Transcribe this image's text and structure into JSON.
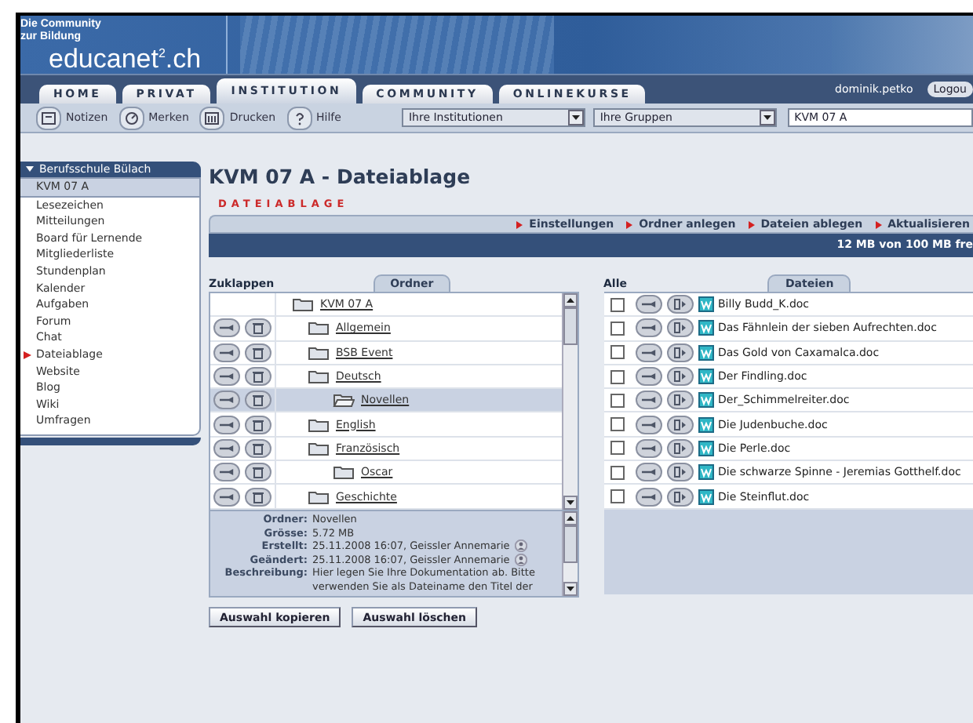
{
  "header": {
    "tagline": [
      "Die Community",
      "zur Bildung"
    ],
    "logo": "educanet$^{2}$.ch"
  },
  "tabs": [
    {
      "label": "HOME",
      "selected": false
    },
    {
      "label": "PRIVAT",
      "selected": false
    },
    {
      "label": "INSTITUTION",
      "selected": true
    },
    {
      "label": "COMMUNITY",
      "selected": false
    },
    {
      "label": "ONLINEKURSE",
      "selected": false
    }
  ],
  "user": {
    "name": "dominik.petko",
    "logout": "Logou"
  },
  "toolbar": {
    "buttons": [
      {
        "label": "Notizen",
        "kind": "notes"
      },
      {
        "label": "Merken",
        "kind": "bookmark"
      },
      {
        "label": "Drucken",
        "kind": "print"
      },
      {
        "label": "Hilfe",
        "kind": "help"
      }
    ],
    "selects": [
      {
        "value": "Ihre Institutionen"
      },
      {
        "value": "Ihre Gruppen"
      }
    ],
    "field": {
      "value": "KVM 07 A"
    }
  },
  "sidebar": {
    "heading": "Berufsschule Bülach",
    "expanded": true,
    "items": [
      {
        "label": "KVM 07 A",
        "selected": true,
        "current": false
      },
      {
        "label": "Lesezeichen",
        "selected": false,
        "current": false
      },
      {
        "label": "Mitteilungen",
        "selected": false,
        "current": false
      },
      {
        "label": "Board für Lernende",
        "selected": false,
        "current": false
      },
      {
        "label": "Mitgliederliste",
        "selected": false,
        "current": false
      },
      {
        "label": "Stundenplan",
        "selected": false,
        "current": false
      },
      {
        "label": "Kalender",
        "selected": false,
        "current": false
      },
      {
        "label": "Aufgaben",
        "selected": false,
        "current": false
      },
      {
        "label": "Forum",
        "selected": false,
        "current": false
      },
      {
        "label": "Chat",
        "selected": false,
        "current": false
      },
      {
        "label": "Dateiablage",
        "selected": false,
        "current": true
      },
      {
        "label": "Website",
        "selected": false,
        "current": false
      },
      {
        "label": "Blog",
        "selected": false,
        "current": false
      },
      {
        "label": "Wiki",
        "selected": false,
        "current": false
      },
      {
        "label": "Umfragen",
        "selected": false,
        "current": false
      }
    ]
  },
  "page_title": "KVM 07 A - Dateiablage",
  "section_label": "DATEIABLAGE",
  "actions": [
    "Einstellungen",
    "Ordner anlegen",
    "Dateien ablegen",
    "Aktualisieren"
  ],
  "quota": "12 MB von 100 MB fre",
  "folders": {
    "collapse_link": "Zuklappen",
    "tab": "Ordner",
    "tree": [
      {
        "name": "KVM 07 A",
        "selected": false,
        "children": [
          {
            "name": "Allgemein",
            "selected": false
          },
          {
            "name": "BSB Event",
            "selected": false
          },
          {
            "name": "Deutsch",
            "selected": false,
            "children": [
              {
                "name": "Novellen",
                "selected": true
              }
            ]
          },
          {
            "name": "English",
            "selected": false
          },
          {
            "name": "Französisch",
            "selected": false,
            "children": [
              {
                "name": "Oscar",
                "selected": false
              }
            ]
          },
          {
            "name": "Geschichte",
            "selected": false
          }
        ]
      }
    ]
  },
  "info": [
    {
      "label": "Ordner:",
      "value": "Novellen",
      "user_icon": false
    },
    {
      "label": "Grösse:",
      "value": "5.72 MB",
      "user_icon": false
    },
    {
      "label": "Erstellt:",
      "value": "25.11.2008 16:07, Geissler Annemarie",
      "user_icon": true
    },
    {
      "label": "Geändert:",
      "value": "25.11.2008 16:07, Geissler Annemarie",
      "user_icon": true
    },
    {
      "label": "Beschreibung:",
      "value": "Hier legen Sie Ihre Dokumentation ab. Bitte verwenden Sie als Dateiname den Titel der",
      "user_icon": false
    }
  ],
  "buttons": [
    "Auswahl kopieren",
    "Auswahl löschen"
  ],
  "files": {
    "select_all": "Alle",
    "tab": "Dateien",
    "rows": [
      {
        "name": "Billy Budd_K.doc",
        "checked": false
      },
      {
        "name": "Das Fähnlein der sieben Aufrechten.doc",
        "checked": false
      },
      {
        "name": "Das Gold von Caxamalca.doc",
        "checked": false
      },
      {
        "name": "Der Findling.doc",
        "checked": false
      },
      {
        "name": "Der_Schimmelreiter.doc",
        "checked": false
      },
      {
        "name": "Die Judenbuche.doc",
        "checked": false
      },
      {
        "name": "Die Perle.doc",
        "checked": false
      },
      {
        "name": "Die schwarze Spinne - Jeremias Gotthelf.doc",
        "checked": false
      },
      {
        "name": "Die Steinflut.doc",
        "checked": false
      }
    ]
  }
}
